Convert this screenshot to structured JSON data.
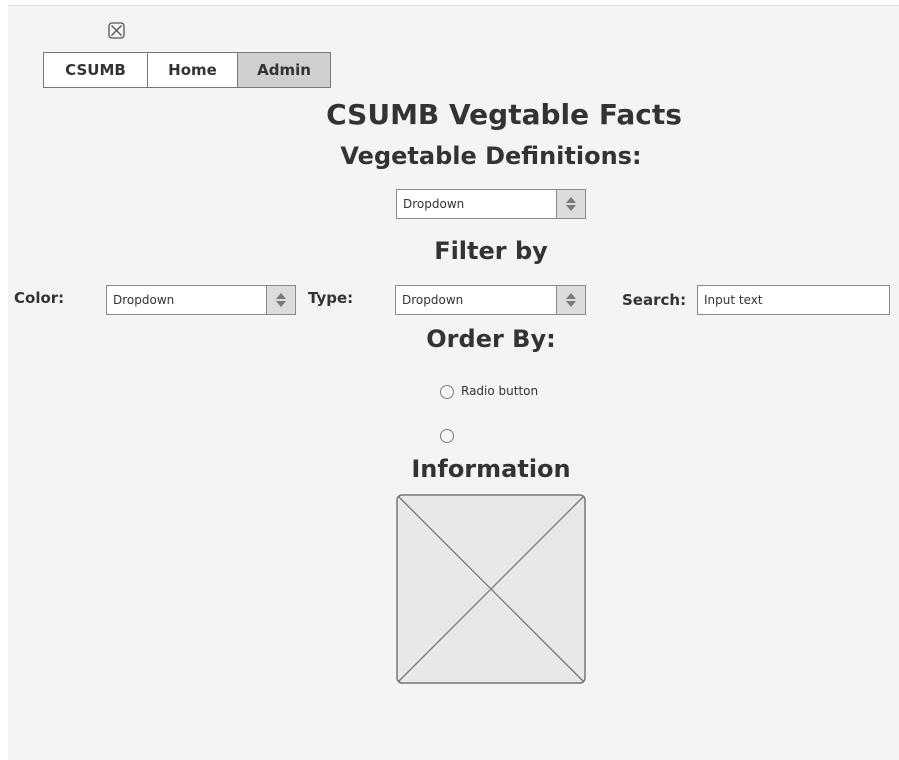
{
  "nav": {
    "tabs": [
      {
        "label": "CSUMB",
        "active": false
      },
      {
        "label": "Home",
        "active": false
      },
      {
        "label": "Admin",
        "active": true
      }
    ]
  },
  "page_title": "CSUMB Vegtable Facts",
  "definitions": {
    "heading": "Vegetable Definitions:",
    "dropdown_value": "Dropdown"
  },
  "filter": {
    "heading": "Filter by",
    "color_label": "Color:",
    "color_value": "Dropdown",
    "type_label": "Type:",
    "type_value": "Dropdown",
    "search_label": "Search:",
    "search_value": "Input text"
  },
  "order": {
    "heading": "Order By:",
    "radios": [
      "Radio button",
      ""
    ]
  },
  "information": {
    "heading": "Information"
  },
  "colors": {
    "active_tab": "#cfcfcf",
    "text": "#333333",
    "canvas": "#f4f4f4"
  },
  "icons": [
    "logo-placeholder-icon",
    "dropdown-arrows-icon",
    "image-placeholder-icon"
  ]
}
